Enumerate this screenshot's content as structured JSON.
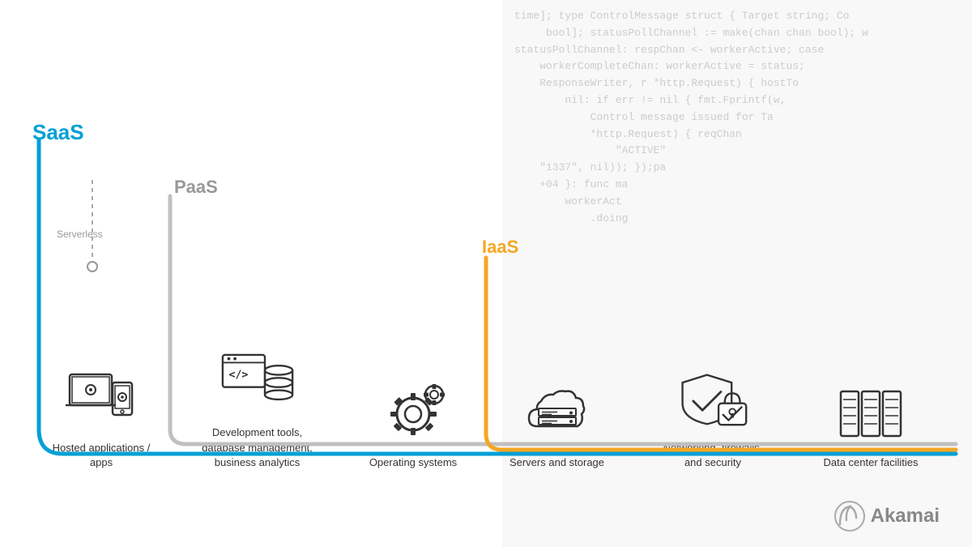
{
  "background_code": [
    "time]; type ControlMessage struct { Target string; Co",
    "bool]; statusPollChannel := make(chan chan bool); w",
    "statusPollChannel: respChan <- workerActive; case",
    "    workerCompleteChan: workerActive = status;",
    "    ResponseWriter, r *http.Request) { hostTo",
    "        nil: if err != nil { fmt.Fprintf(w,",
    "            Control message issued for Ta",
    "            *http.Request) { reqChan",
    "                \"ACTIVE\"",
    "    \"1337\", nil)); });pa",
    "    +04 }: func ma",
    "        workerAct",
    "            .doing"
  ],
  "labels": {
    "saas": "SaaS",
    "paas": "PaaS",
    "iaas": "IaaS",
    "serverless": "Serverless"
  },
  "icons": [
    {
      "id": "hosted-apps",
      "label": "Hosted applications / apps",
      "type": "apps"
    },
    {
      "id": "dev-tools",
      "label": "Development tools, database management, business analytics",
      "type": "devtools"
    },
    {
      "id": "operating-systems",
      "label": "Operating systems",
      "type": "os"
    },
    {
      "id": "servers-storage",
      "label": "Servers and storage",
      "type": "servers"
    },
    {
      "id": "networking",
      "label": "Networking, firewalls, and security",
      "type": "networking"
    },
    {
      "id": "datacenter",
      "label": "Data center facilities",
      "type": "datacenter"
    }
  ],
  "akamai": {
    "text": "Akamai"
  },
  "colors": {
    "saas": "#00a0d6",
    "paas": "#999999",
    "iaas": "#f5a623",
    "text_dark": "#333333",
    "text_light": "#999999"
  }
}
